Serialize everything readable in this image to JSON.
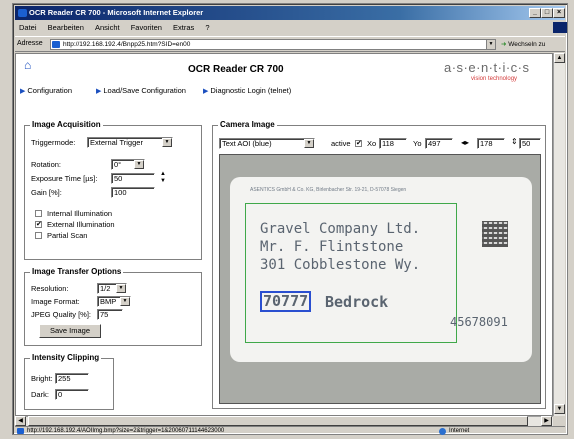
{
  "window": {
    "title": "OCR Reader CR 700 - Microsoft Internet Explorer",
    "min": "_",
    "max": "□",
    "close": "×"
  },
  "menu": [
    "Datei",
    "Bearbeiten",
    "Ansicht",
    "Favoriten",
    "Extras",
    "?"
  ],
  "address": {
    "label": "Adresse",
    "url": "http://192.168.192.4/Bnpp25.htm?SID=en00",
    "go_label": "Wechseln zu"
  },
  "header": {
    "title": "OCR Reader CR 700",
    "logo_text": "a·s·e·n·t·i·c·s",
    "logo_sub": "vision technology",
    "nav": [
      "Configuration",
      "Load/Save Configuration",
      "Diagnostic Login (telnet)"
    ]
  },
  "acquisition": {
    "legend": "Image Acquisition",
    "triggermode_label": "Triggermode:",
    "triggermode_value": "External Trigger",
    "rotation_label": "Rotation:",
    "rotation_value": "0°",
    "exposure_label": "Exposure Time [µs]:",
    "exposure_value": "50",
    "gain_label": "Gain [%]:",
    "gain_value": "100",
    "checkboxes": [
      {
        "label": "Internal Illumination",
        "checked": ""
      },
      {
        "label": "External Illumination",
        "checked": "✔"
      },
      {
        "label": "Partial Scan",
        "checked": ""
      }
    ]
  },
  "transfer": {
    "legend": "Image Transfer Options",
    "resolution_label": "Resolution:",
    "resolution_value": "1/2",
    "format_label": "Image Format:",
    "format_value": "BMP",
    "jpeg_label": "JPEG Quality [%]:",
    "jpeg_value": "75",
    "save_label": "Save Image"
  },
  "clipping": {
    "legend": "Intensity Clipping",
    "bright_label": "Bright:",
    "bright_value": "255",
    "dark_label": "Dark:",
    "dark_value": "0"
  },
  "camera": {
    "legend": "Camera Image",
    "aoi_value": "Text AOI (blue)",
    "active_label": "active",
    "active_checked": "✔",
    "xo_label": "Xo",
    "xo_value": "118",
    "yo_label": "Yo",
    "yo_value": "497",
    "width_value": "178",
    "height_value": "50",
    "card": {
      "header": "ASENTICS GmbH & Co. KG, Birlenbacher Str. 19-21, D-57078 Siegen",
      "line1": "Gravel Company Ltd.",
      "line2": "Mr. F. Flintstone",
      "line3": "301 Cobblestone Wy.",
      "zip": "70777",
      "city": "Bedrock",
      "number": "45678091"
    }
  },
  "status": {
    "url": "http://192.168.192.4/AOIImg.bmp?size=2&trigger=1&20060711144623000",
    "zone": "Internet"
  },
  "colors": {
    "accent": "#1b4fbf",
    "ocr_box": "#2a4fd0",
    "aoi_box": "#3fa84a"
  }
}
